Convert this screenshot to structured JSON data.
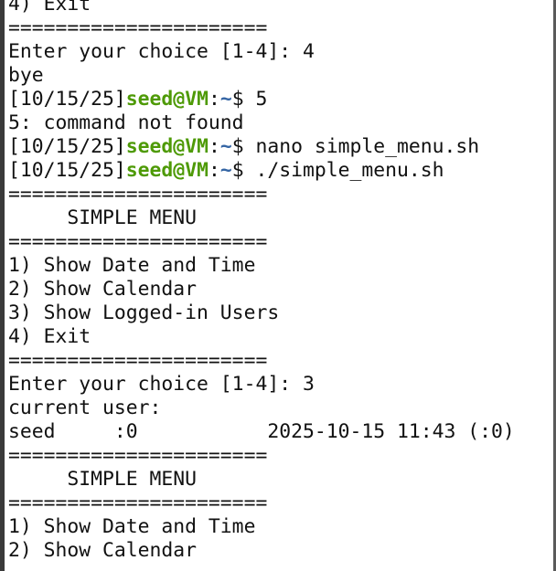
{
  "terminal": {
    "lines": [
      {
        "type": "text",
        "text": "4) Exit"
      },
      {
        "type": "text",
        "text": "======================"
      },
      {
        "type": "text",
        "text": "Enter your choice [1-4]: 4"
      },
      {
        "type": "text",
        "text": "bye"
      },
      {
        "type": "prompt",
        "time": "[10/15/25]",
        "user": "seed@VM",
        "sep": ":",
        "path": "~",
        "symbol": "$ ",
        "command": "5"
      },
      {
        "type": "text",
        "text": "5: command not found"
      },
      {
        "type": "prompt",
        "time": "[10/15/25]",
        "user": "seed@VM",
        "sep": ":",
        "path": "~",
        "symbol": "$ ",
        "command": "nano simple_menu.sh"
      },
      {
        "type": "prompt",
        "time": "[10/15/25]",
        "user": "seed@VM",
        "sep": ":",
        "path": "~",
        "symbol": "$ ",
        "command": "./simple_menu.sh"
      },
      {
        "type": "text",
        "text": "======================"
      },
      {
        "type": "text",
        "text": "     SIMPLE MENU"
      },
      {
        "type": "text",
        "text": "======================"
      },
      {
        "type": "text",
        "text": "1) Show Date and Time"
      },
      {
        "type": "text",
        "text": "2) Show Calendar"
      },
      {
        "type": "text",
        "text": "3) Show Logged-in Users"
      },
      {
        "type": "text",
        "text": "4) Exit"
      },
      {
        "type": "text",
        "text": "======================"
      },
      {
        "type": "text",
        "text": "Enter your choice [1-4]: 3"
      },
      {
        "type": "text",
        "text": "current user:"
      },
      {
        "type": "text",
        "text": "seed     :0           2025-10-15 11:43 (:0)"
      },
      {
        "type": "text",
        "text": "======================"
      },
      {
        "type": "text",
        "text": "     SIMPLE MENU"
      },
      {
        "type": "text",
        "text": "======================"
      },
      {
        "type": "text",
        "text": "1) Show Date and Time"
      },
      {
        "type": "text",
        "text": "2) Show Calendar"
      }
    ]
  },
  "colors": {
    "background": "#ffffff",
    "foreground": "#111111",
    "prompt_user": "#4e9a06",
    "prompt_path": "#3465a4"
  }
}
